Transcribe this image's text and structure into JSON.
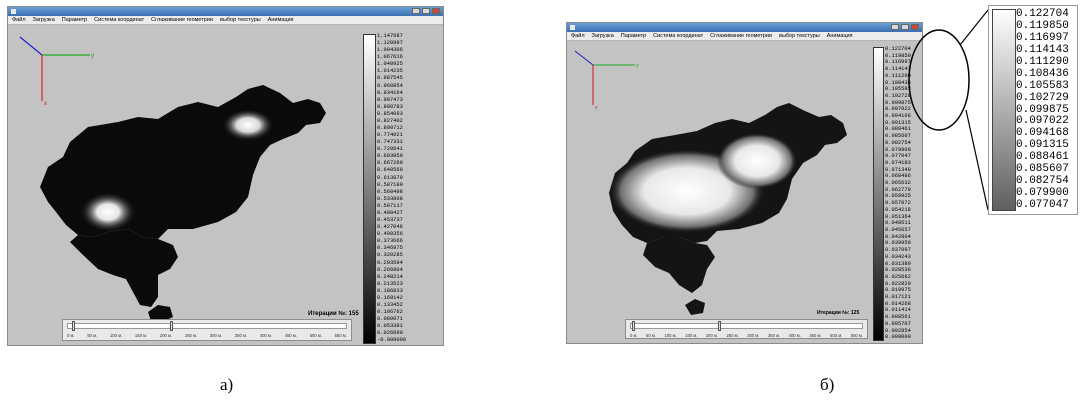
{
  "panel_a": {
    "window_title": "",
    "menu": [
      "Файл",
      "Загрузка",
      "Параметр",
      "Система координат",
      "Сглаживание геометрии",
      "выбор текстуры",
      "Анимация"
    ],
    "axes": {
      "x": "x",
      "y": "y"
    },
    "scale_values": [
      "1.147687",
      "1.120997",
      "1.094306",
      "1.067616",
      "1.040925",
      "1.014235",
      "0.987545",
      "0.960854",
      "0.934164",
      "0.907473",
      "0.880783",
      "0.854093",
      "0.827402",
      "0.800712",
      "0.774021",
      "0.747331",
      "0.720641",
      "0.693950",
      "0.667260",
      "0.640569",
      "0.613879",
      "0.587189",
      "0.560498",
      "0.533808",
      "0.507117",
      "0.480427",
      "0.453737",
      "0.427046",
      "0.400356",
      "0.373666",
      "0.346975",
      "0.320285",
      "0.293594",
      "0.266904",
      "0.240214",
      "0.213523",
      "0.186833",
      "0.160142",
      "0.133452",
      "0.106762",
      "0.080071",
      "0.053381",
      "0.026690",
      "-0.000000"
    ],
    "iteration": "Итерации №: 155",
    "timeline_ticks": [
      "0 м.",
      "50 м.",
      "100 м.",
      "150 м.",
      "200 м.",
      "250 м.",
      "300 м.",
      "350 м.",
      "400 м.",
      "450 м.",
      "500 м.",
      "550 м."
    ]
  },
  "panel_b": {
    "window_title": "",
    "menu": [
      "Файл",
      "Загрузка",
      "Параметр",
      "Система координат",
      "Сглаживание геометрии",
      "выбор текстуры",
      "Анимация"
    ],
    "axes": {
      "x": "x",
      "y": "y"
    },
    "scale_values": [
      "0.122704",
      "0.119850",
      "0.116997",
      "0.114143",
      "0.111290",
      "0.108436",
      "0.105583",
      "0.102729",
      "0.099875",
      "0.097022",
      "0.094168",
      "0.091315",
      "0.088461",
      "0.085607",
      "0.082754",
      "0.079900",
      "0.077047",
      "0.074193",
      "0.071340",
      "0.068486",
      "0.065632",
      "0.062779",
      "0.059925",
      "0.057072",
      "0.054218",
      "0.051364",
      "0.048511",
      "0.045657",
      "0.042804",
      "0.039950",
      "0.037097",
      "0.034243",
      "0.031389",
      "0.028536",
      "0.025682",
      "0.022829",
      "0.019975",
      "0.017121",
      "0.014268",
      "0.011414",
      "0.008561",
      "0.005707",
      "0.002854",
      "0.000000"
    ],
    "iteration": "Итерации №: 125",
    "timeline_ticks": [
      "0 м.",
      "50 м.",
      "100 м.",
      "150 м.",
      "200 м.",
      "250 м.",
      "300 м.",
      "350 м.",
      "400 м.",
      "450 м.",
      "500 м.",
      "550 м."
    ]
  },
  "zoom_values": [
    "0.122704",
    "0.119850",
    "0.116997",
    "0.114143",
    "0.111290",
    "0.108436",
    "0.105583",
    "0.102729",
    "0.099875",
    "0.097022",
    "0.094168",
    "0.091315",
    "0.088461",
    "0.085607",
    "0.082754",
    "0.079900",
    "0.077047"
  ],
  "captions": {
    "a": "а)",
    "b": "б)"
  },
  "colors": {
    "background": "#c3c3c3",
    "titlebar": "#3b6fb0",
    "axis_x": "#d22",
    "axis_y": "#2a2",
    "axis_z": "#22c"
  }
}
